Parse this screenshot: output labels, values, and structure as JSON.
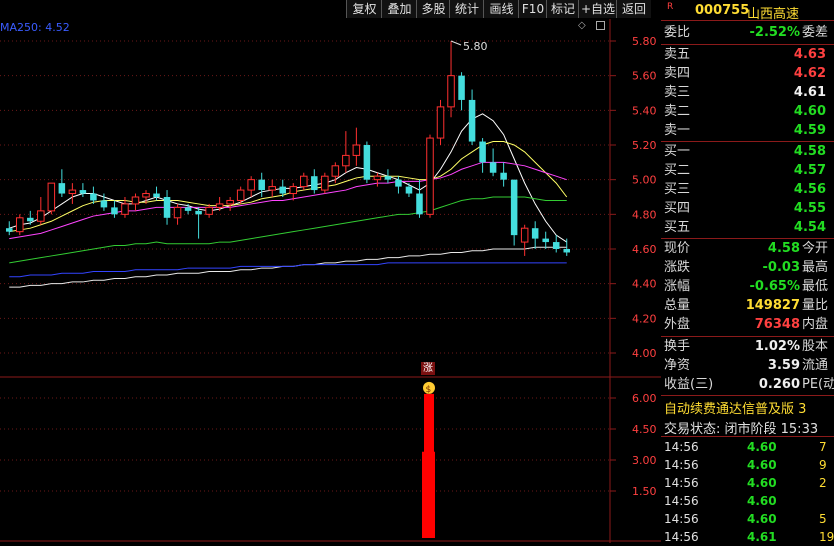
{
  "toolbar": {
    "buttons": [
      "复权",
      "叠加",
      "多股",
      "统计",
      "画线",
      "F10",
      "标记",
      "+自选",
      "返回"
    ]
  },
  "indicator": {
    "ma_label": "MA250: 4.52",
    "high_marker": "5.80",
    "zhang_badge": "涨",
    "money_badge": "$"
  },
  "stock": {
    "r_badge": "R",
    "code": "000755",
    "name": "山西高速"
  },
  "quote": {
    "weibi": {
      "label": "委比",
      "value": "-2.52%",
      "sub": "委差"
    },
    "asks": [
      {
        "label": "卖五",
        "price": "4.63"
      },
      {
        "label": "卖四",
        "price": "4.62"
      },
      {
        "label": "卖三",
        "price": "4.61"
      },
      {
        "label": "卖二",
        "price": "4.60"
      },
      {
        "label": "卖一",
        "price": "4.59"
      }
    ],
    "bids": [
      {
        "label": "买一",
        "price": "4.58"
      },
      {
        "label": "买二",
        "price": "4.57"
      },
      {
        "label": "买三",
        "price": "4.56"
      },
      {
        "label": "买四",
        "price": "4.55"
      },
      {
        "label": "买五",
        "price": "4.54"
      }
    ],
    "stats": [
      {
        "label": "现价",
        "value": "4.58",
        "sub": "今开",
        "color": "green"
      },
      {
        "label": "涨跌",
        "value": "-0.03",
        "sub": "最高",
        "color": "green"
      },
      {
        "label": "涨幅",
        "value": "-0.65%",
        "sub": "最低",
        "color": "green"
      },
      {
        "label": "总量",
        "value": "149827",
        "sub": "量比",
        "color": "yellow"
      },
      {
        "label": "外盘",
        "value": "76348",
        "sub": "内盘",
        "color": "red"
      }
    ],
    "stats2": [
      {
        "label": "换手",
        "value": "1.02%",
        "sub": "股本"
      },
      {
        "label": "净资",
        "value": "3.59",
        "sub": "流通"
      },
      {
        "label": "收益(三)",
        "value": "0.260",
        "sub": "PE(动)"
      }
    ],
    "marquee": "自动续费通达信普及版 3",
    "status": "交易状态: 闭市阶段 15:33",
    "ticks": [
      {
        "time": "14:56",
        "price": "4.60",
        "vol": "7"
      },
      {
        "time": "14:56",
        "price": "4.60",
        "vol": "9"
      },
      {
        "time": "14:56",
        "price": "4.60",
        "vol": "2"
      },
      {
        "time": "14:56",
        "price": "4.60",
        "vol": ""
      },
      {
        "time": "14:56",
        "price": "4.60",
        "vol": "5"
      },
      {
        "time": "14:56",
        "price": "4.61",
        "vol": "19"
      }
    ]
  },
  "chart_data": {
    "type": "candlestick",
    "price_axis": {
      "ticks": [
        "5.80",
        "5.60",
        "5.40",
        "5.20",
        "5.00",
        "4.80",
        "4.60",
        "4.40",
        "4.20",
        "4.00"
      ],
      "range": [
        3.9,
        5.9
      ]
    },
    "volume_axis": {
      "ticks": [
        "6.00",
        "4.50",
        "3.00",
        "1.50"
      ],
      "range": [
        0,
        7
      ]
    },
    "candles": [
      {
        "o": 4.72,
        "h": 4.76,
        "l": 4.68,
        "c": 4.7
      },
      {
        "o": 4.7,
        "h": 4.8,
        "l": 4.68,
        "c": 4.78
      },
      {
        "o": 4.78,
        "h": 4.82,
        "l": 4.74,
        "c": 4.76
      },
      {
        "o": 4.76,
        "h": 4.9,
        "l": 4.74,
        "c": 4.82
      },
      {
        "o": 4.82,
        "h": 4.98,
        "l": 4.8,
        "c": 4.98
      },
      {
        "o": 4.98,
        "h": 5.06,
        "l": 4.9,
        "c": 4.92
      },
      {
        "o": 4.92,
        "h": 4.98,
        "l": 4.86,
        "c": 4.94
      },
      {
        "o": 4.94,
        "h": 4.98,
        "l": 4.9,
        "c": 4.92
      },
      {
        "o": 4.92,
        "h": 4.96,
        "l": 4.86,
        "c": 4.88
      },
      {
        "o": 4.88,
        "h": 4.92,
        "l": 4.82,
        "c": 4.84
      },
      {
        "o": 4.84,
        "h": 4.88,
        "l": 4.78,
        "c": 4.8
      },
      {
        "o": 4.8,
        "h": 4.9,
        "l": 4.78,
        "c": 4.86
      },
      {
        "o": 4.86,
        "h": 4.92,
        "l": 4.82,
        "c": 4.9
      },
      {
        "o": 4.9,
        "h": 4.94,
        "l": 4.86,
        "c": 4.92
      },
      {
        "o": 4.92,
        "h": 4.96,
        "l": 4.88,
        "c": 4.9
      },
      {
        "o": 4.9,
        "h": 4.94,
        "l": 4.74,
        "c": 4.78
      },
      {
        "o": 4.78,
        "h": 4.86,
        "l": 4.74,
        "c": 4.84
      },
      {
        "o": 4.84,
        "h": 4.86,
        "l": 4.8,
        "c": 4.82
      },
      {
        "o": 4.82,
        "h": 4.84,
        "l": 4.66,
        "c": 4.8
      },
      {
        "o": 4.8,
        "h": 4.86,
        "l": 4.78,
        "c": 4.84
      },
      {
        "o": 4.84,
        "h": 4.9,
        "l": 4.82,
        "c": 4.86
      },
      {
        "o": 4.86,
        "h": 4.9,
        "l": 4.82,
        "c": 4.88
      },
      {
        "o": 4.88,
        "h": 4.96,
        "l": 4.86,
        "c": 4.94
      },
      {
        "o": 4.94,
        "h": 5.02,
        "l": 4.9,
        "c": 5.0
      },
      {
        "o": 5.0,
        "h": 5.04,
        "l": 4.9,
        "c": 4.94
      },
      {
        "o": 4.94,
        "h": 5.0,
        "l": 4.9,
        "c": 4.96
      },
      {
        "o": 4.96,
        "h": 5.0,
        "l": 4.9,
        "c": 4.92
      },
      {
        "o": 4.92,
        "h": 4.98,
        "l": 4.88,
        "c": 4.96
      },
      {
        "o": 4.96,
        "h": 5.04,
        "l": 4.94,
        "c": 5.02
      },
      {
        "o": 5.02,
        "h": 5.06,
        "l": 4.92,
        "c": 4.94
      },
      {
        "o": 4.94,
        "h": 5.04,
        "l": 4.92,
        "c": 5.02
      },
      {
        "o": 5.02,
        "h": 5.1,
        "l": 4.98,
        "c": 5.08
      },
      {
        "o": 5.08,
        "h": 5.28,
        "l": 5.04,
        "c": 5.14
      },
      {
        "o": 5.14,
        "h": 5.3,
        "l": 5.08,
        "c": 5.2
      },
      {
        "o": 5.2,
        "h": 5.22,
        "l": 4.98,
        "c": 5.0
      },
      {
        "o": 5.0,
        "h": 5.04,
        "l": 4.96,
        "c": 5.02
      },
      {
        "o": 5.02,
        "h": 5.06,
        "l": 4.98,
        "c": 5.0
      },
      {
        "o": 5.0,
        "h": 5.02,
        "l": 4.92,
        "c": 4.96
      },
      {
        "o": 4.96,
        "h": 4.98,
        "l": 4.9,
        "c": 4.92
      },
      {
        "o": 4.92,
        "h": 5.0,
        "l": 4.78,
        "c": 4.8
      },
      {
        "o": 4.8,
        "h": 5.26,
        "l": 4.78,
        "c": 5.24
      },
      {
        "o": 5.24,
        "h": 5.46,
        "l": 5.2,
        "c": 5.42
      },
      {
        "o": 5.42,
        "h": 5.8,
        "l": 5.36,
        "c": 5.6
      },
      {
        "o": 5.6,
        "h": 5.62,
        "l": 5.4,
        "c": 5.46
      },
      {
        "o": 5.46,
        "h": 5.52,
        "l": 5.2,
        "c": 5.22
      },
      {
        "o": 5.22,
        "h": 5.24,
        "l": 5.04,
        "c": 5.1
      },
      {
        "o": 5.1,
        "h": 5.18,
        "l": 5.02,
        "c": 5.04
      },
      {
        "o": 5.04,
        "h": 5.1,
        "l": 4.96,
        "c": 5.0
      },
      {
        "o": 5.0,
        "h": 5.0,
        "l": 4.62,
        "c": 4.68
      },
      {
        "o": 4.64,
        "h": 4.74,
        "l": 4.56,
        "c": 4.72
      },
      {
        "o": 4.72,
        "h": 4.76,
        "l": 4.6,
        "c": 4.66
      },
      {
        "o": 4.66,
        "h": 4.7,
        "l": 4.6,
        "c": 4.64
      },
      {
        "o": 4.64,
        "h": 4.68,
        "l": 4.58,
        "c": 4.6
      },
      {
        "o": 4.6,
        "h": 4.66,
        "l": 4.56,
        "c": 4.58
      }
    ],
    "ma_series": [
      {
        "color": "#ffffff",
        "values": [
          4.72,
          4.74,
          4.75,
          4.78,
          4.82,
          4.86,
          4.9,
          4.92,
          4.92,
          4.9,
          4.88,
          4.86,
          4.86,
          4.88,
          4.9,
          4.88,
          4.86,
          4.85,
          4.83,
          4.82,
          4.83,
          4.85,
          4.87,
          4.9,
          4.93,
          4.94,
          4.95,
          4.95,
          4.96,
          4.97,
          4.98,
          5.0,
          5.04,
          5.07,
          5.06,
          5.04,
          5.02,
          5.0,
          4.97,
          4.94,
          4.98,
          5.06,
          5.16,
          5.28,
          5.35,
          5.38,
          5.34,
          5.26,
          5.12,
          4.98,
          4.86,
          4.76,
          4.68,
          4.64
        ]
      },
      {
        "color": "#ffff66",
        "values": [
          4.7,
          4.71,
          4.72,
          4.74,
          4.76,
          4.79,
          4.82,
          4.85,
          4.87,
          4.88,
          4.88,
          4.88,
          4.87,
          4.87,
          4.88,
          4.88,
          4.88,
          4.87,
          4.86,
          4.85,
          4.85,
          4.85,
          4.86,
          4.87,
          4.89,
          4.9,
          4.91,
          4.93,
          4.94,
          4.95,
          4.96,
          4.97,
          4.99,
          5.01,
          5.02,
          5.02,
          5.02,
          5.02,
          5.01,
          5.0,
          5.0,
          5.02,
          5.06,
          5.12,
          5.16,
          5.2,
          5.22,
          5.22,
          5.2,
          5.16,
          5.1,
          5.04,
          4.98,
          4.9
        ]
      },
      {
        "color": "#ff44ff",
        "values": [
          4.66,
          4.67,
          4.68,
          4.69,
          4.71,
          4.73,
          4.75,
          4.77,
          4.79,
          4.8,
          4.81,
          4.82,
          4.82,
          4.83,
          4.84,
          4.84,
          4.84,
          4.84,
          4.84,
          4.84,
          4.84,
          4.84,
          4.85,
          4.86,
          4.87,
          4.88,
          4.88,
          4.89,
          4.9,
          4.91,
          4.92,
          4.93,
          4.94,
          4.96,
          4.97,
          4.98,
          4.98,
          4.99,
          4.99,
          4.99,
          5.0,
          5.01,
          5.03,
          5.06,
          5.08,
          5.1,
          5.1,
          5.1,
          5.09,
          5.08,
          5.06,
          5.04,
          5.02,
          5.0
        ]
      },
      {
        "color": "#33cc33",
        "values": [
          4.52,
          4.53,
          4.54,
          4.55,
          4.56,
          4.57,
          4.58,
          4.59,
          4.6,
          4.61,
          4.62,
          4.62,
          4.63,
          4.63,
          4.64,
          4.63,
          4.63,
          4.63,
          4.63,
          4.63,
          4.64,
          4.64,
          4.65,
          4.66,
          4.67,
          4.68,
          4.69,
          4.7,
          4.71,
          4.72,
          4.73,
          4.74,
          4.75,
          4.76,
          4.77,
          4.78,
          4.79,
          4.8,
          4.8,
          4.81,
          4.82,
          4.84,
          4.86,
          4.88,
          4.89,
          4.89,
          4.9,
          4.9,
          4.9,
          4.9,
          4.89,
          4.88,
          4.88,
          4.88
        ]
      },
      {
        "color": "#e8e8e8",
        "values": [
          4.38,
          4.38,
          4.39,
          4.39,
          4.4,
          4.4,
          4.41,
          4.41,
          4.42,
          4.42,
          4.43,
          4.43,
          4.44,
          4.44,
          4.45,
          4.45,
          4.46,
          4.46,
          4.46,
          4.47,
          4.47,
          4.47,
          4.48,
          4.48,
          4.49,
          4.49,
          4.5,
          4.5,
          4.51,
          4.51,
          4.52,
          4.52,
          4.53,
          4.53,
          4.54,
          4.54,
          4.55,
          4.55,
          4.56,
          4.56,
          4.57,
          4.57,
          4.58,
          4.58,
          4.59,
          4.59,
          4.6,
          4.6,
          4.6,
          4.6,
          4.61,
          4.61,
          4.61,
          4.61
        ]
      },
      {
        "color": "#3344ff",
        "values": [
          4.44,
          4.44,
          4.45,
          4.45,
          4.45,
          4.46,
          4.46,
          4.46,
          4.47,
          4.47,
          4.47,
          4.47,
          4.48,
          4.48,
          4.48,
          4.48,
          4.48,
          4.49,
          4.49,
          4.49,
          4.49,
          4.49,
          4.5,
          4.5,
          4.5,
          4.5,
          4.5,
          4.5,
          4.51,
          4.51,
          4.51,
          4.51,
          4.51,
          4.51,
          4.51,
          4.51,
          4.52,
          4.52,
          4.52,
          4.52,
          4.52,
          4.52,
          4.52,
          4.52,
          4.52,
          4.52,
          4.52,
          4.52,
          4.52,
          4.52,
          4.52,
          4.52,
          4.52,
          4.52
        ]
      }
    ],
    "volume_bar": {
      "value_top": 6.2,
      "value_mid": 3.4
    }
  }
}
